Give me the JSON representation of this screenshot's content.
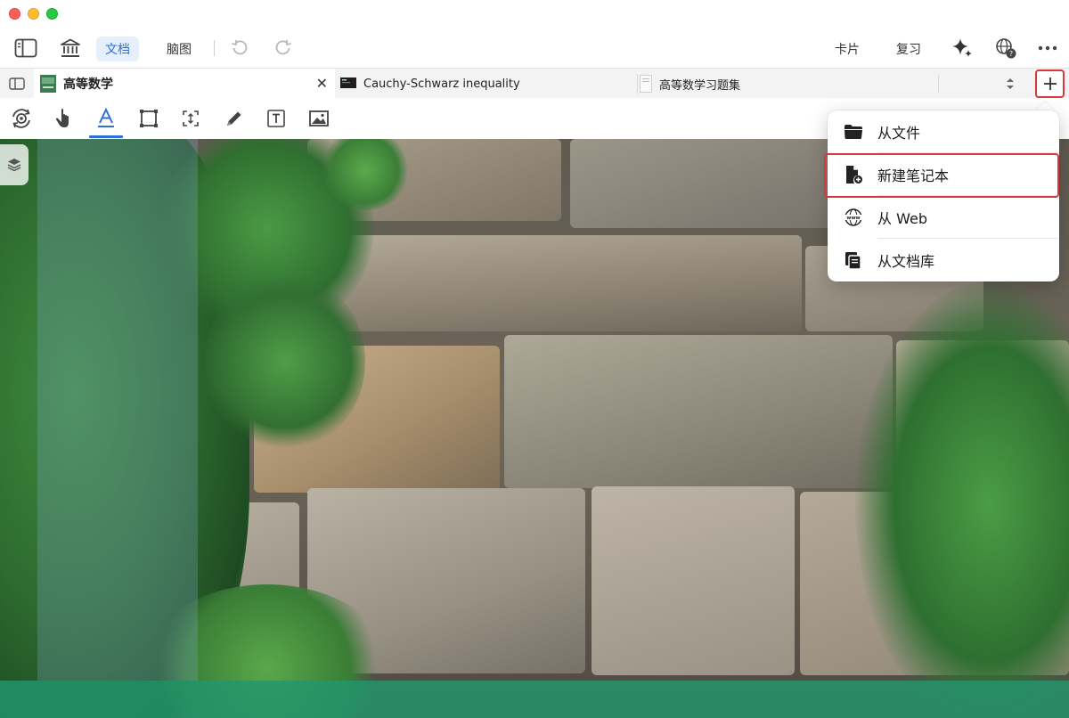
{
  "toolbar": {
    "tab_doc": "文档",
    "tab_mindmap": "脑图",
    "cards": "卡片",
    "review": "复习"
  },
  "doc_tabs": [
    {
      "label": "高等数学",
      "active": true
    },
    {
      "label": "Cauchy-Schwarz inequality",
      "active": false
    },
    {
      "label": "高等数学习题集",
      "active": false
    }
  ],
  "add_menu": {
    "items": [
      {
        "label": "从文件",
        "icon": "folder-icon"
      },
      {
        "label": "新建笔记本",
        "icon": "new-notebook-icon",
        "highlighted": true
      },
      {
        "label": "从 Web",
        "icon": "web-icon"
      },
      {
        "label": "从文档库",
        "icon": "library-icon"
      }
    ]
  },
  "colors": {
    "accent": "#2f6fd9",
    "highlight_border": "#d9363e",
    "bottom_band": "#22966e"
  }
}
